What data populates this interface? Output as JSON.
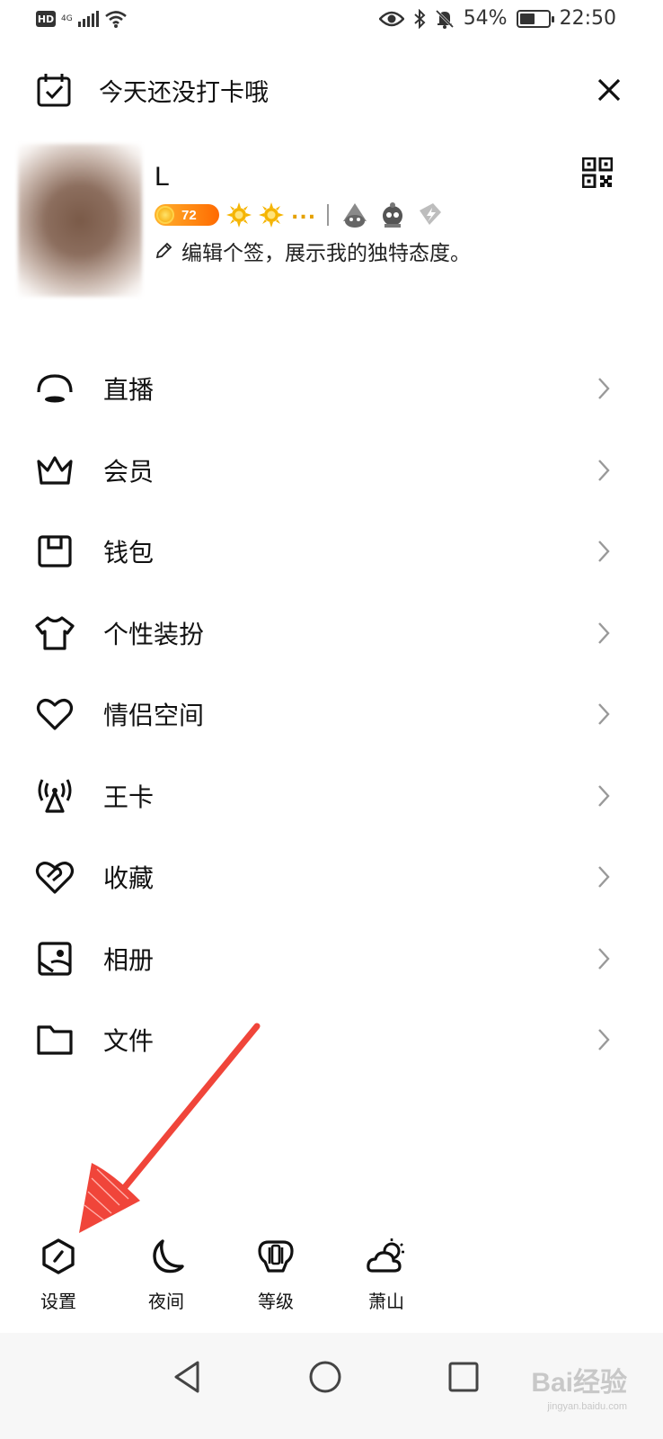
{
  "status_bar": {
    "hd": "HD",
    "network_gen": "4G",
    "battery_percent": "54%",
    "battery_level": 0.54,
    "time": "22:50"
  },
  "checkin": {
    "text": "今天还没打卡哦"
  },
  "profile": {
    "name": "L",
    "level": "72",
    "more_badges": "...",
    "signature": "编辑个签，展示我的独特态度。"
  },
  "menu": {
    "items": [
      {
        "label": "直播",
        "icon": "live-icon"
      },
      {
        "label": "会员",
        "icon": "crown-icon"
      },
      {
        "label": "钱包",
        "icon": "wallet-icon"
      },
      {
        "label": "个性装扮",
        "icon": "tshirt-icon"
      },
      {
        "label": "情侣空间",
        "icon": "heart-icon"
      },
      {
        "label": "王卡",
        "icon": "signal-tower-icon"
      },
      {
        "label": "收藏",
        "icon": "favorite-icon"
      },
      {
        "label": "相册",
        "icon": "album-icon"
      },
      {
        "label": "文件",
        "icon": "folder-icon"
      }
    ]
  },
  "quick_actions": {
    "settings": "设置",
    "night": "夜间",
    "level": "等级",
    "weather": "萧山"
  },
  "watermark": {
    "brand": "Bai经验",
    "url": "jingyan.baidu.com"
  },
  "colors": {
    "annotation_arrow": "#f0453a",
    "level_pill": "#ff7a0a",
    "badge_gold": "#f5b400"
  }
}
